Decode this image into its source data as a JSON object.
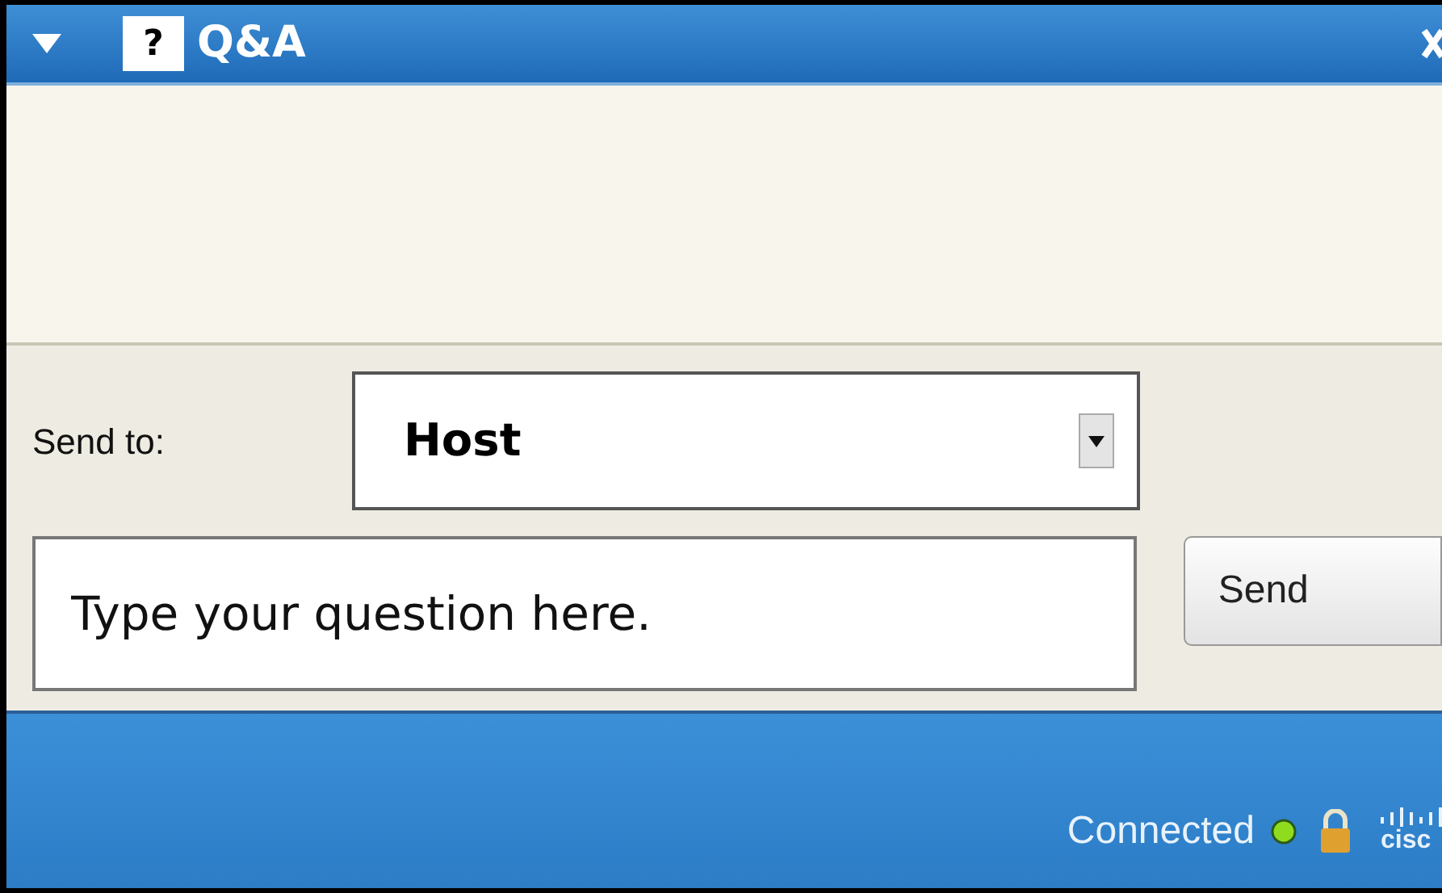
{
  "window": {
    "title": "Q&A",
    "title_badge": "?",
    "collapsed": false
  },
  "send_to": {
    "label": "Send to:",
    "value": "Host"
  },
  "question": {
    "placeholder": "Type your question here."
  },
  "send_button": {
    "label": "Send"
  },
  "status_bar": {
    "text": "Connected",
    "connected": true,
    "logo_text": "cisc"
  }
}
